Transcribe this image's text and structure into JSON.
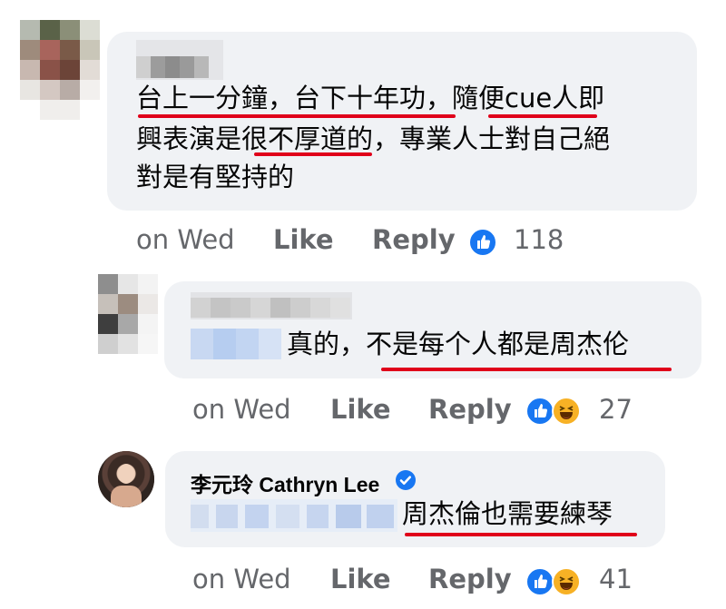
{
  "comments": [
    {
      "lines": [
        "台上一分鐘，台下十年功，隨便cue人即",
        "興表演是很不厚道的，專業人士對自己絕",
        "對是有堅持的"
      ],
      "time": "on Wed",
      "like": "Like",
      "reply": "Reply",
      "count": "118"
    },
    {
      "text": "真的，不是每个人都是周杰伦",
      "time": "on Wed",
      "like": "Like",
      "reply": "Reply",
      "count": "27"
    },
    {
      "author": "李元玲 Cathryn Lee",
      "text": "周杰倫也需要練琴",
      "time": "on Wed",
      "like": "Like",
      "reply": "Reply",
      "count": "41"
    }
  ],
  "colors": {
    "bubble": "#f0f2f5",
    "underline": "#e0001a",
    "like_blue": "#1877f2",
    "meta_gray": "#65676b"
  }
}
